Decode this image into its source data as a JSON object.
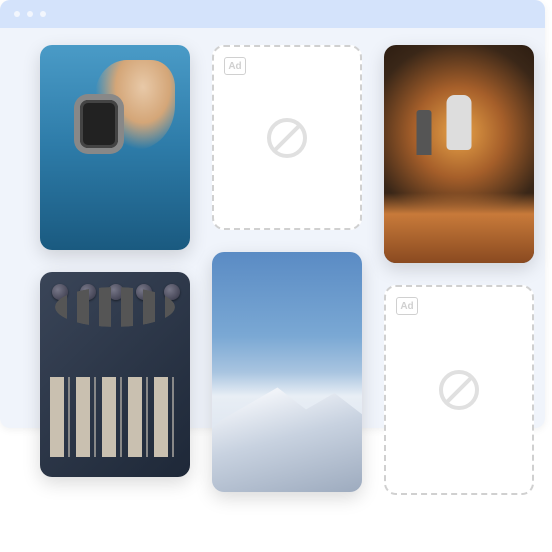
{
  "ad": {
    "label": "Ad"
  },
  "cards": {
    "col1": [
      {
        "type": "image",
        "name": "smartwatch-photo"
      },
      {
        "type": "image",
        "name": "audio-mixer-photo"
      }
    ],
    "col2": [
      {
        "type": "ad",
        "name": "ad-placeholder-1"
      },
      {
        "type": "image",
        "name": "snow-mountain-photo"
      }
    ],
    "col3": [
      {
        "type": "image",
        "name": "concert-stage-photo"
      },
      {
        "type": "ad",
        "name": "ad-placeholder-2"
      }
    ]
  }
}
